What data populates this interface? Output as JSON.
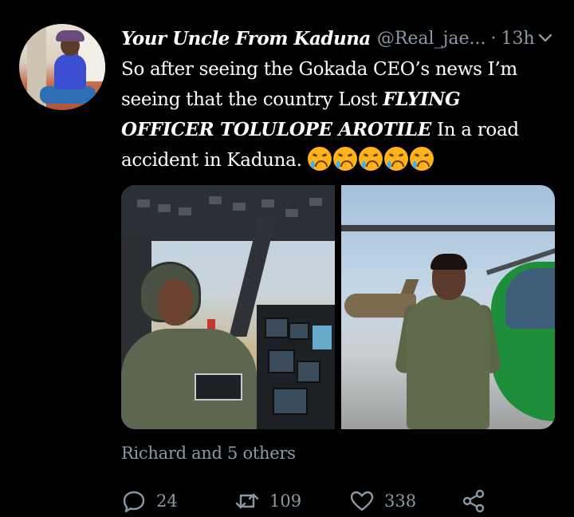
{
  "tweet": {
    "author_name": "Your Uncle From Kaduna",
    "handle": "@Real_jae...",
    "separator": "·",
    "time": "13h",
    "text_part1": "So after seeing the Gokada CEO’s news I’m seeing that the country Lost ",
    "text_bold": "FLYING OFFICER TOLULOPE AROTILE",
    "text_part2": " In a road accident in Kaduna. ",
    "emoji_count": 5,
    "liked_by": "Richard and 5 others",
    "reply_count": "24",
    "retweet_count": "109",
    "like_count": "338"
  },
  "icons": {
    "menu": "chevron-down-icon",
    "reply": "reply-icon",
    "retweet": "retweet-icon",
    "like": "heart-icon",
    "share": "share-icon"
  },
  "colors": {
    "background": "#000000",
    "text": "#ffffff",
    "muted": "#8b98a5"
  }
}
